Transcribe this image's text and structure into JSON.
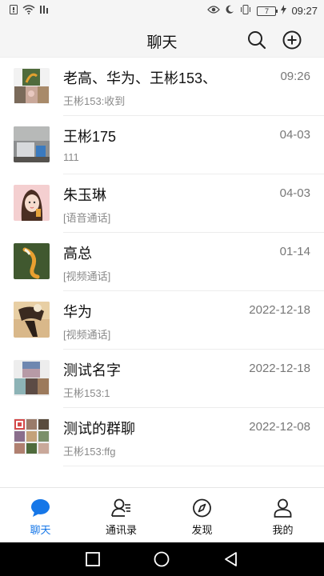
{
  "status_bar": {
    "time": "09:27",
    "battery": "7"
  },
  "header": {
    "title": "聊天"
  },
  "chats": [
    {
      "name": "老高、华为、王彬153、",
      "time": "09:26",
      "preview": "王彬153:收到"
    },
    {
      "name": "王彬175",
      "time": "04-03",
      "preview": "111"
    },
    {
      "name": "朱玉琳",
      "time": "04-03",
      "preview": "[语音通话]"
    },
    {
      "name": "高总",
      "time": "01-14",
      "preview": "[视频通话]"
    },
    {
      "name": "华为",
      "time": "2022-12-18",
      "preview": "[视频通话]"
    },
    {
      "name": "测试名字",
      "time": "2022-12-18",
      "preview": "王彬153:1"
    },
    {
      "name": "测试的群聊",
      "time": "2022-12-08",
      "preview": "王彬153:ffg"
    }
  ],
  "tabs": [
    {
      "label": "聊天",
      "icon": "chat-bubble-icon",
      "active": true
    },
    {
      "label": "通讯录",
      "icon": "contacts-icon",
      "active": false
    },
    {
      "label": "发现",
      "icon": "compass-icon",
      "active": false
    },
    {
      "label": "我的",
      "icon": "person-icon",
      "active": false
    }
  ],
  "colors": {
    "accent": "#1677e8",
    "header_bg": "#f5f5f5",
    "nav_bg": "#000000"
  }
}
